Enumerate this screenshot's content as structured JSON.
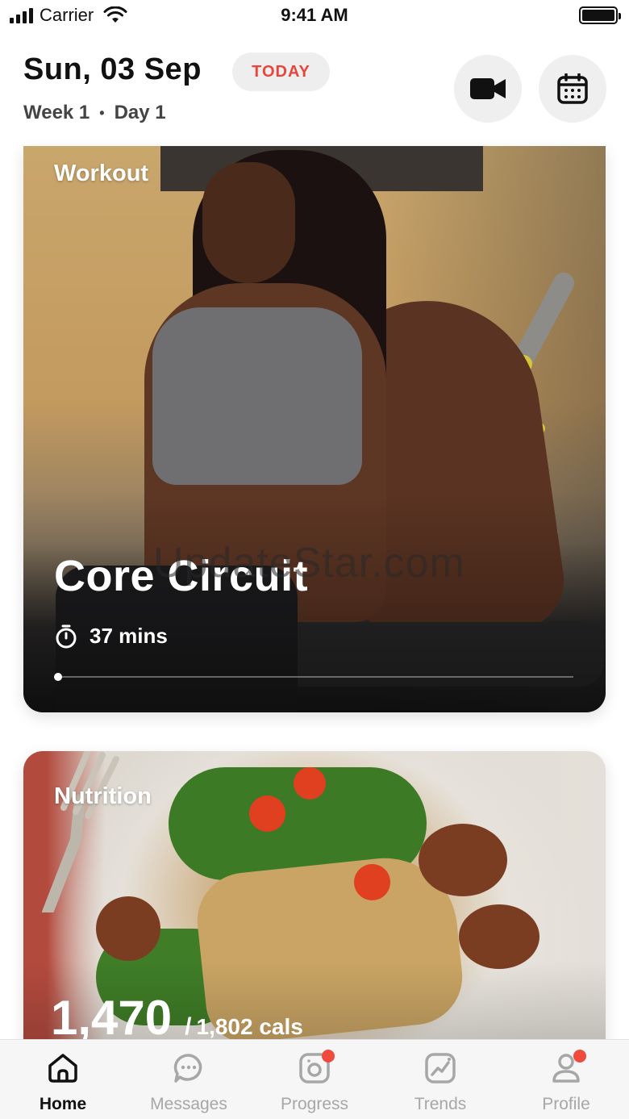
{
  "status_bar": {
    "carrier": "Carrier",
    "time": "9:41 AM"
  },
  "header": {
    "date": "Sun, 03 Sep",
    "today_badge": "TODAY",
    "week": "Week 1",
    "separator": "•",
    "day": "Day 1",
    "actions": [
      "video-camera-icon",
      "calendar-icon"
    ]
  },
  "workout_card": {
    "label": "Workout",
    "title": "Core Circuit",
    "duration": "37 mins",
    "duration_icon": "stopwatch-icon",
    "progress": 0
  },
  "watermark": "UpdateStar.com",
  "nutrition_card": {
    "label": "Nutrition",
    "consumed": "1,470",
    "separator": "/",
    "target": "1,802 cals"
  },
  "tab_bar": {
    "tabs": [
      {
        "label": "Home",
        "icon": "home-icon",
        "active": true,
        "badge": false
      },
      {
        "label": "Messages",
        "icon": "chat-bubble-icon",
        "active": false,
        "badge": false
      },
      {
        "label": "Progress",
        "icon": "camera-progress-icon",
        "active": false,
        "badge": true
      },
      {
        "label": "Trends",
        "icon": "trend-chart-icon",
        "active": false,
        "badge": false
      },
      {
        "label": "Profile",
        "icon": "user-icon",
        "active": false,
        "badge": true
      }
    ]
  },
  "colors": {
    "accent": "#e8453c",
    "badge_dot": "#ef4a3b",
    "tab_inactive": "#a7a7a7",
    "tab_active": "#111111"
  }
}
